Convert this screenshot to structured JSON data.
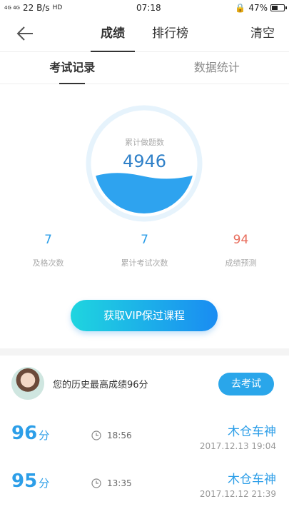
{
  "status_bar": {
    "network": "4G 4G",
    "speed": "22 B/s",
    "time": "07:18",
    "battery_percent": "47%",
    "battery_level": 0.47
  },
  "nav": {
    "tabs": [
      {
        "label": "成绩",
        "active": true
      },
      {
        "label": "排行榜",
        "active": false
      }
    ],
    "clear_label": "清空"
  },
  "sub_tabs": [
    {
      "label": "考试记录",
      "active": true
    },
    {
      "label": "数据统计",
      "active": false
    }
  ],
  "summary": {
    "label": "累计做题数",
    "value": "4946"
  },
  "stats": [
    {
      "value": "7",
      "label": "及格次数"
    },
    {
      "value": "7",
      "label": "累计考试次数"
    },
    {
      "value": "94",
      "label": "成绩预测"
    }
  ],
  "vip_button": "获取VIP保过课程",
  "best": {
    "text": "您的历史最高成绩96分",
    "button": "去考试"
  },
  "records": [
    {
      "score": "96",
      "unit": "分",
      "duration": "18:56",
      "name": "木仓车神",
      "date": "2017.12.13  19:04"
    },
    {
      "score": "95",
      "unit": "分",
      "duration": "13:35",
      "name": "木仓车神",
      "date": "2017.12.12  21:39"
    }
  ],
  "colors": {
    "accent": "#2c9ee8",
    "prediction": "#e86c5b",
    "vip_gradient_start": "#1fd5df",
    "vip_gradient_end": "#1a8cf2"
  }
}
